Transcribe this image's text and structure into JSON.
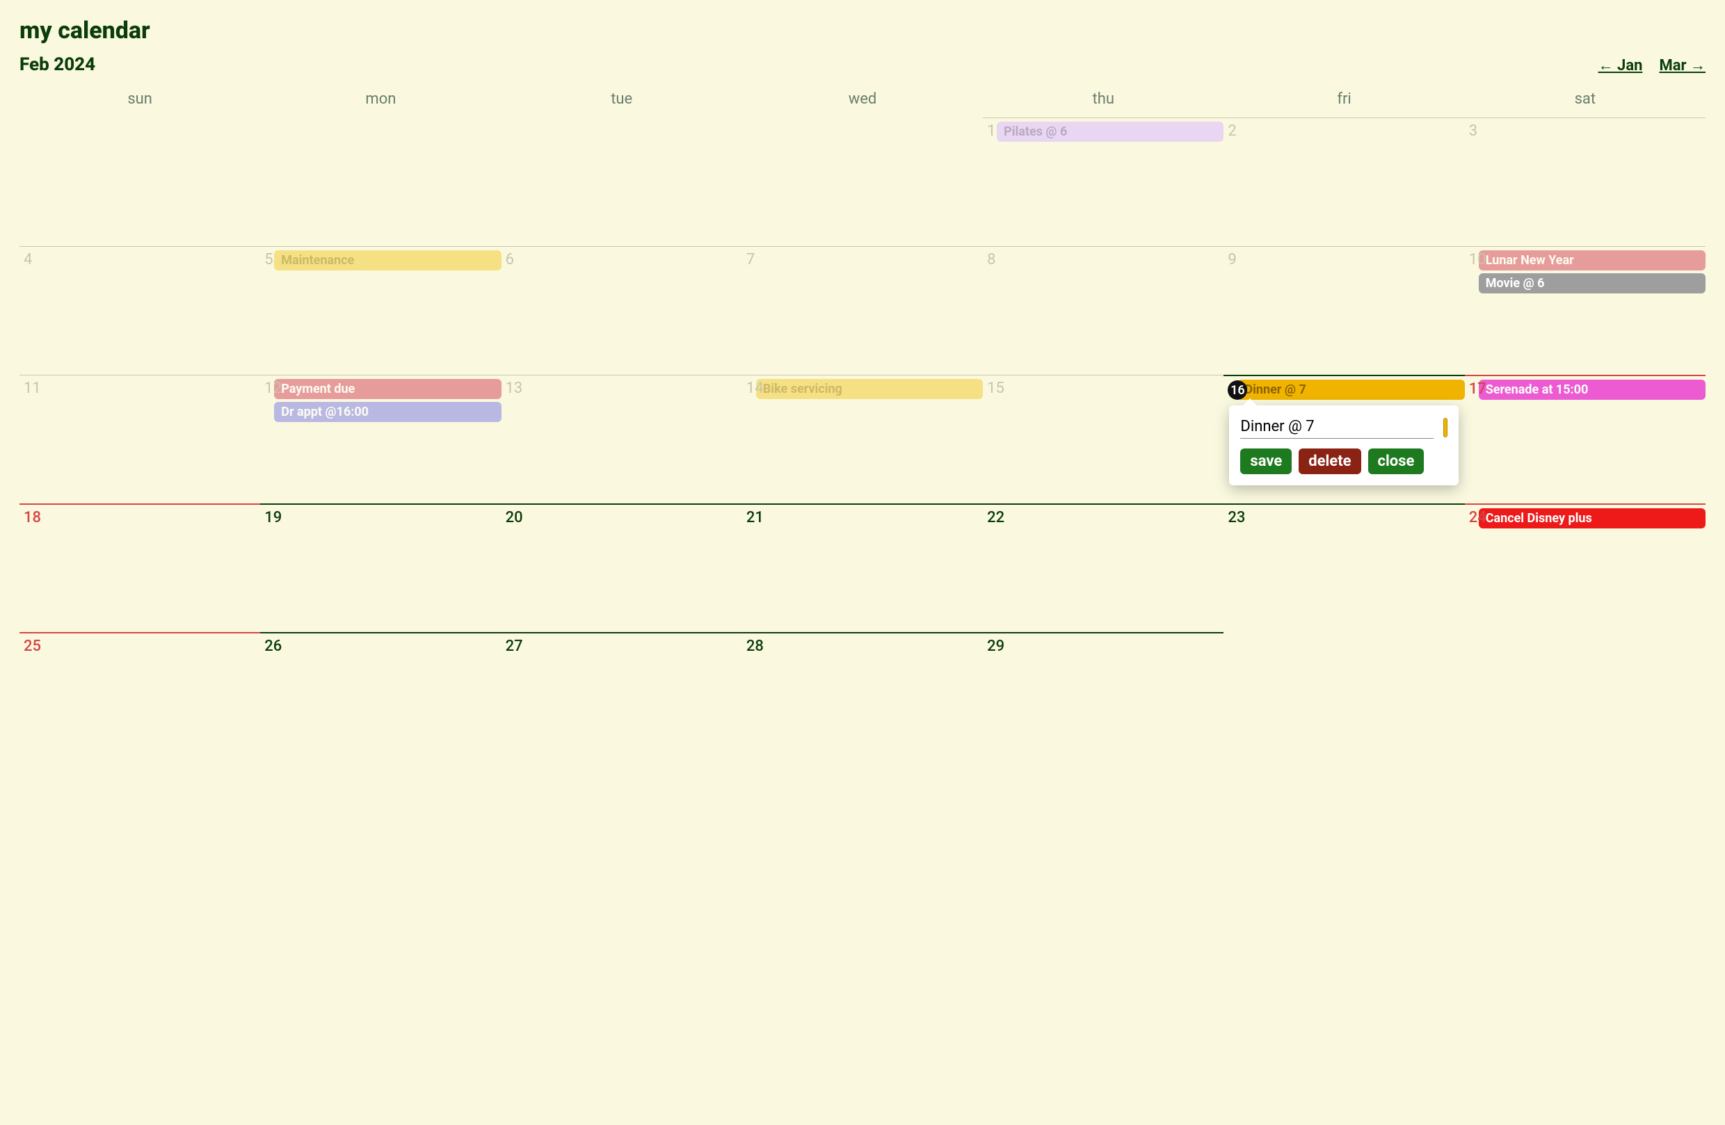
{
  "header": {
    "title": "my calendar",
    "month_year": "Feb 2024",
    "prev_link": "← Jan",
    "next_link": "Mar →"
  },
  "days_of_week": [
    "sun",
    "mon",
    "tue",
    "wed",
    "thu",
    "fri",
    "sat"
  ],
  "today": 16,
  "cells": [
    {
      "day": null
    },
    {
      "day": null
    },
    {
      "day": null
    },
    {
      "day": null
    },
    {
      "day": 1,
      "state": "past",
      "events": [
        {
          "label": "Pilates @ 6",
          "color": "purple"
        }
      ]
    },
    {
      "day": 2,
      "state": "past"
    },
    {
      "day": 3,
      "state": "past"
    },
    {
      "day": 4,
      "state": "past"
    },
    {
      "day": 5,
      "state": "past",
      "events": [
        {
          "label": "Maintenance",
          "color": "yellow-p"
        }
      ]
    },
    {
      "day": 6,
      "state": "past"
    },
    {
      "day": 7,
      "state": "past"
    },
    {
      "day": 8,
      "state": "past"
    },
    {
      "day": 9,
      "state": "past"
    },
    {
      "day": 10,
      "state": "past",
      "events": [
        {
          "label": "Lunar New Year",
          "color": "salmon-p"
        },
        {
          "label": "Movie @ 6",
          "color": "gray"
        }
      ]
    },
    {
      "day": 11,
      "state": "past"
    },
    {
      "day": 12,
      "state": "past",
      "events": [
        {
          "label": "Payment due",
          "color": "salmon-p"
        },
        {
          "label": "Dr appt @16:00",
          "color": "lav"
        }
      ]
    },
    {
      "day": 13,
      "state": "past"
    },
    {
      "day": 14,
      "state": "past",
      "events": [
        {
          "label": "Bike servicing",
          "color": "yellow-p"
        }
      ]
    },
    {
      "day": 15,
      "state": "past"
    },
    {
      "day": 16,
      "state": "today",
      "events": [
        {
          "label": "Dinner @ 7",
          "color": "gold"
        }
      ]
    },
    {
      "day": 17,
      "state": "future-weekend",
      "events": [
        {
          "label": "Serenade at 15:00",
          "color": "magenta"
        }
      ]
    },
    {
      "day": 18,
      "state": "future-weekend"
    },
    {
      "day": 19,
      "state": "future"
    },
    {
      "day": 20,
      "state": "future"
    },
    {
      "day": 21,
      "state": "future"
    },
    {
      "day": 22,
      "state": "future"
    },
    {
      "day": 23,
      "state": "future"
    },
    {
      "day": 24,
      "state": "future-weekend",
      "events": [
        {
          "label": "Cancel Disney plus",
          "color": "red"
        }
      ]
    },
    {
      "day": 25,
      "state": "future-weekend"
    },
    {
      "day": 26,
      "state": "future"
    },
    {
      "day": 27,
      "state": "future"
    },
    {
      "day": 28,
      "state": "future"
    },
    {
      "day": 29,
      "state": "future"
    },
    {
      "day": null
    },
    {
      "day": null
    }
  ],
  "popup": {
    "visible_on_day": 16,
    "input_value": "Dinner @ 7",
    "swatch_color": "#f0b400",
    "save_label": "save",
    "delete_label": "delete",
    "close_label": "close"
  }
}
